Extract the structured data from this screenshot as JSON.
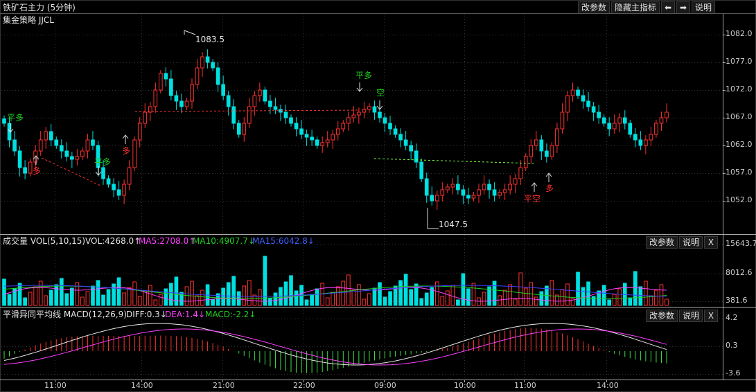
{
  "header": {
    "title": "铁矿石主力 (5分钟)",
    "strategy": "集金策略 JJCL"
  },
  "top_buttons": {
    "params": "改参数",
    "hide": "隐藏主指标",
    "left": "⬅",
    "right": "➡",
    "help": "说明"
  },
  "vol_panel": {
    "title": "成交量 VOL(5,10,15)",
    "vol": "VOL:4268.0↑",
    "ma5": "MA5:2708.0↑",
    "ma10": "MA10:4907.7↓",
    "ma15": "MA15:6042.8↓",
    "buttons": {
      "params": "改参数",
      "help": "说明",
      "close": "X"
    }
  },
  "macd_panel": {
    "title": "平滑异同平均线 MACD(12,26,9)",
    "diff": "DIFF:0.3↓",
    "dea": "DEA:1.4↓",
    "macd": "MACD:-2.2↓",
    "buttons": {
      "params": "改参数",
      "help": "说明",
      "close": "X"
    }
  },
  "annotations": {
    "high": "1083.5",
    "low": "1047.5",
    "pingduo": "平多",
    "duo": "多",
    "kong": "空",
    "pingkong": "平空"
  },
  "colors": {
    "up": "#ff3232",
    "down": "#00e0e0",
    "ma5": "#ff40ff",
    "ma10": "#20d020",
    "ma15": "#4040ff",
    "green_text": "#20d020",
    "red_text": "#ff3232"
  },
  "chart_data": {
    "type": "candlestick",
    "price_axis": {
      "ticks": [
        "1082.0",
        "1077.0",
        "1072.0",
        "1067.0",
        "1062.0",
        "1057.0",
        "1052.0"
      ],
      "ylim": [
        1046,
        1086
      ]
    },
    "vol_axis": {
      "ticks": [
        "15643.7",
        "8012.6",
        "381.6"
      ]
    },
    "macd_axis": {
      "ticks": [
        "4.2",
        "0.3",
        "-3.6"
      ]
    },
    "x_ticks": [
      "11:00",
      "14:00",
      "21:00",
      "22:00",
      "09:00",
      "10:00",
      "11:00",
      "14:00"
    ]
  }
}
